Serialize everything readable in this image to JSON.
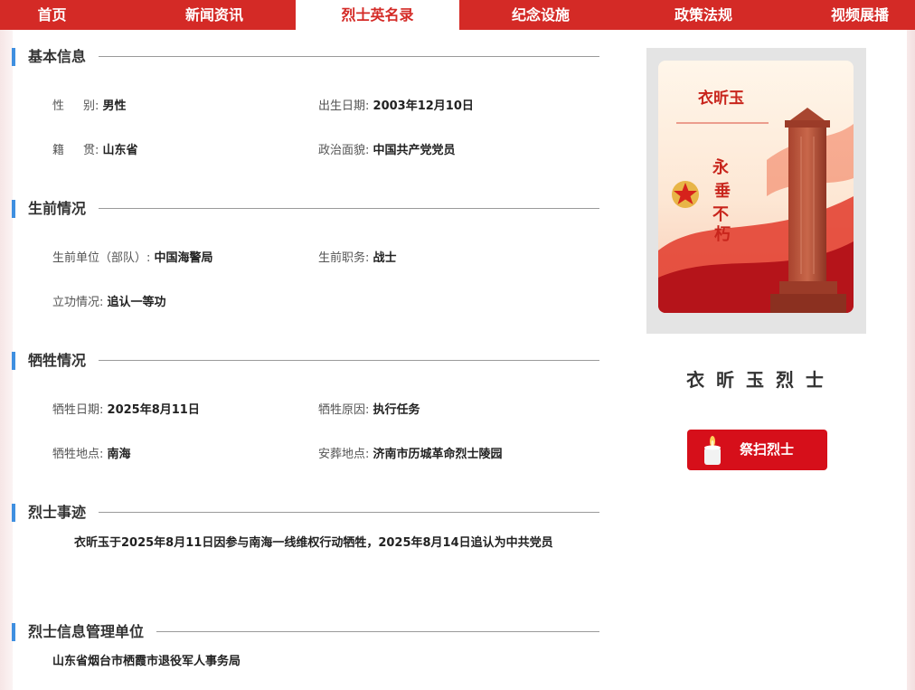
{
  "nav": {
    "items": [
      "首页",
      "新闻资讯",
      "烈士英名录",
      "纪念设施",
      "政策法规",
      "视频展播"
    ],
    "active_index": 2
  },
  "basic": {
    "title": "基本信息",
    "gender_label": "性",
    "gender_label2": "别:",
    "gender": "男性",
    "birth_label": "出生日期:",
    "birth": "2003年12月10日",
    "origin_label": "籍",
    "origin_label2": "贯:",
    "origin": "山东省",
    "politics_label": "政治面貌:",
    "politics": "中国共产党党员"
  },
  "life": {
    "title": "生前情况",
    "unit_label": "生前单位（部队）:",
    "unit": "中国海警局",
    "post_label": "生前职务:",
    "post": "战士",
    "merit_label": "立功情况:",
    "merit": "追认一等功"
  },
  "sacrifice": {
    "title": "牺牲情况",
    "date_label": "牺牲日期:",
    "date": "2025年8月11日",
    "reason_label": "牺牲原因:",
    "reason": "执行任务",
    "place_label": "牺牲地点:",
    "place": "南海",
    "burial_label": "安葬地点:",
    "burial": "济南市历城革命烈士陵园"
  },
  "deeds": {
    "title": "烈士事迹",
    "text": "衣昕玉于2025年8月11日因参与南海一线维权行动牺牲，2025年8月14日追认为中共党员"
  },
  "management": {
    "title": "烈士信息管理单位",
    "unit": "山东省烟台市栖霞市退役军人事务局"
  },
  "portrait": {
    "name_on_image": "衣昕玉",
    "slogan": [
      "永",
      "垂",
      "不",
      "朽"
    ]
  },
  "hero_name": "衣 昕 玉  烈 士",
  "tribute_button": "祭扫烈士",
  "colors": {
    "nav_red": "#d42a26",
    "accent_blue": "#3f8fe0",
    "button_red": "#d60f1a"
  }
}
